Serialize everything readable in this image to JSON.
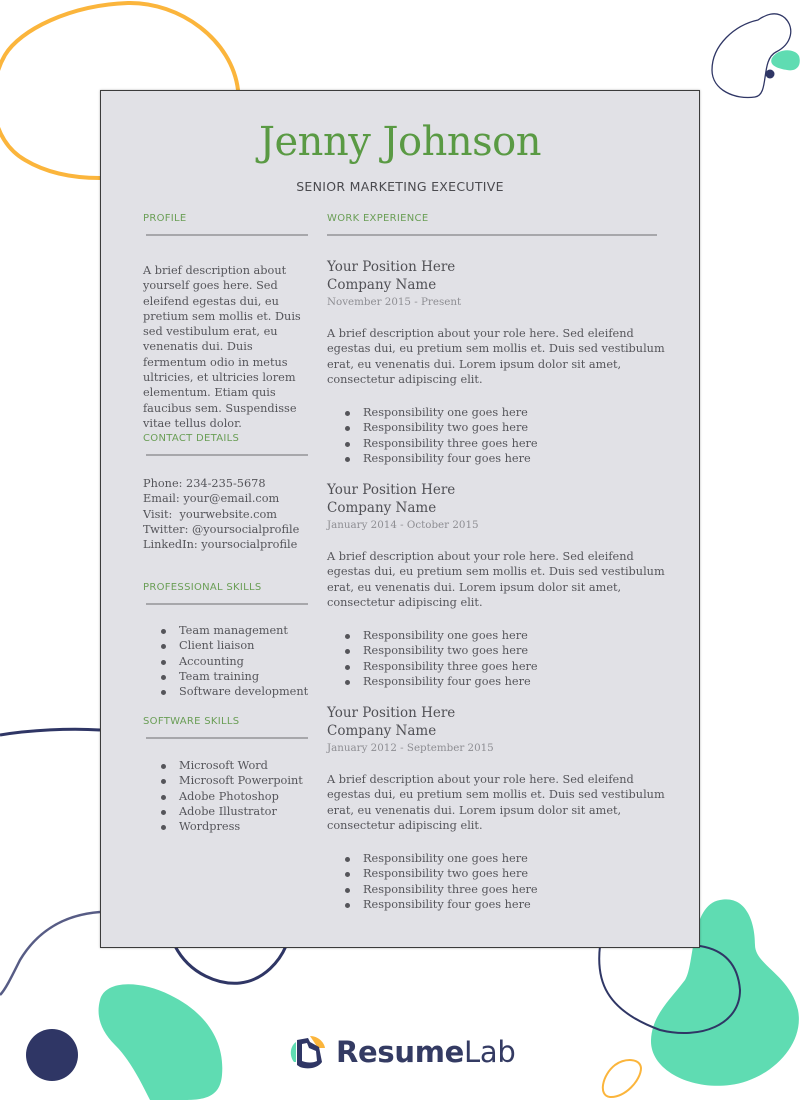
{
  "resume": {
    "name": "Jenny Johnson",
    "job_title": "SENIOR MARKETING EXECUTIVE",
    "accent_color": "#5a9a44",
    "profile": {
      "heading": "PROFILE",
      "text": "A brief description about yourself goes here. Sed eleifend egestas dui, eu pretium sem mollis et. Duis sed vestibulum erat, eu venenatis dui. Duis fermentum odio in metus ultricies, et ultricies lorem elementum. Etiam quis faucibus sem. Suspendisse vitae tellus dolor."
    },
    "contact": {
      "heading": "CONTACT DETAILS",
      "lines": [
        "Phone: 234-235-5678",
        "Email: your@email.com",
        "Visit:  yourwebsite.com",
        "Twitter: @yoursocialprofile",
        "LinkedIn: yoursocialprofile"
      ]
    },
    "professional_skills": {
      "heading": "PROFESSIONAL SKILLS",
      "items": [
        "Team management",
        "Client liaison",
        "Accounting",
        "Team training",
        "Software development"
      ]
    },
    "software_skills": {
      "heading": "SOFTWARE SKILLS",
      "items": [
        "Microsoft Word",
        "Microsoft Powerpoint",
        "Adobe Photoshop",
        "Adobe Illustrator",
        "Wordpress"
      ]
    },
    "work_experience": {
      "heading": "WORK EXPERIENCE",
      "jobs": [
        {
          "position": "Your Position Here",
          "company": "Company Name",
          "dates": "November 2015 - Present",
          "description": "A brief description about your role here. Sed eleifend egestas dui, eu pretium sem mollis et. Duis sed vestibulum erat, eu venenatis dui. Lorem ipsum dolor sit amet, consectetur adipiscing elit.",
          "responsibilities": [
            "Responsibility one goes here",
            "Responsibility two goes here",
            "Responsibility three goes here",
            "Responsibility four goes here"
          ]
        },
        {
          "position": "Your Position Here",
          "company": "Company Name",
          "dates": "January 2014 - October 2015",
          "description": "A brief description about your role here. Sed eleifend egestas dui, eu pretium sem mollis et. Duis sed vestibulum erat, eu venenatis dui. Lorem ipsum dolor sit amet, consectetur adipiscing elit.",
          "responsibilities": [
            "Responsibility one goes here",
            "Responsibility two goes here",
            "Responsibility three goes here",
            "Responsibility four goes here"
          ]
        },
        {
          "position": "Your Position Here",
          "company": "Company Name",
          "dates": "January 2012 - September 2015",
          "description": "A brief description about your role here. Sed eleifend egestas dui, eu pretium sem mollis et. Duis sed vestibulum erat, eu venenatis dui. Lorem ipsum dolor sit amet, consectetur adipiscing elit.",
          "responsibilities": [
            "Responsibility one goes here",
            "Responsibility two goes here",
            "Responsibility three goes here",
            "Responsibility four goes here"
          ]
        }
      ]
    }
  },
  "branding": {
    "logo_icon": "resumelab-logo-icon",
    "logo_bold": "Resume",
    "logo_light": "Lab",
    "colors": {
      "navy": "#2f3665",
      "mint": "#5fdcb2",
      "orange": "#fbb53c"
    }
  }
}
